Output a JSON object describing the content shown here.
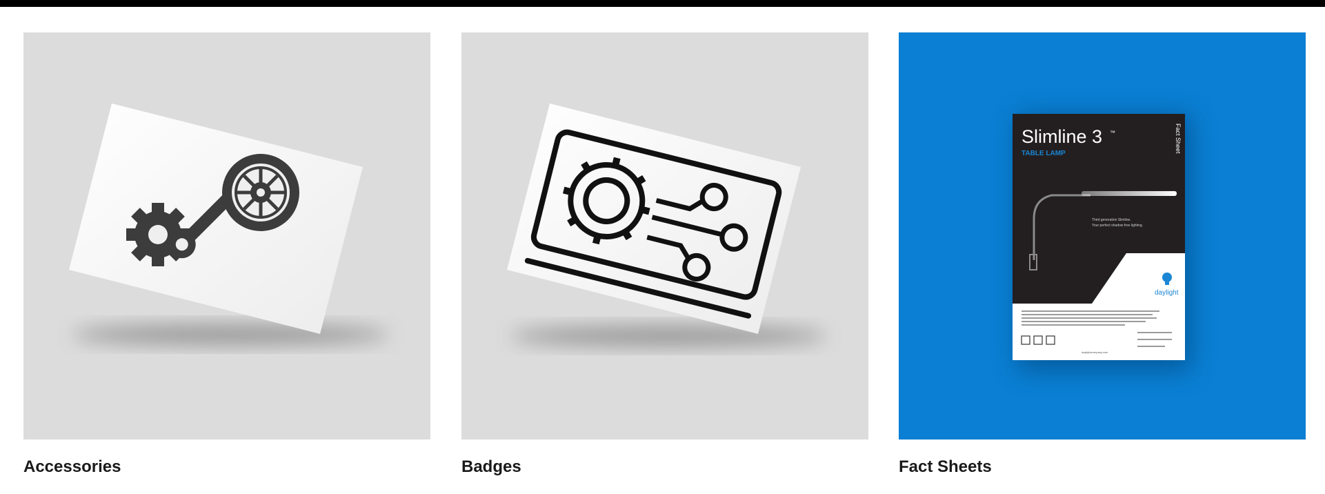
{
  "cards": [
    {
      "title": "Accessories"
    },
    {
      "title": "Badges"
    },
    {
      "title": "Fact Sheets",
      "booklet": {
        "heading": "Slimline 3",
        "trademark": "™",
        "subheading": "TABLE LAMP",
        "side_label": "Fact Sheet",
        "tagline_1": "Third generation Slimline.",
        "tagline_2": "Your perfect shadow free lighting.",
        "brand": "daylight",
        "url": "daylightcompany.com"
      }
    }
  ],
  "colors": {
    "card_grey": "#dcdcdc",
    "card_blue": "#0a7fd3",
    "booklet_dark": "#231f20",
    "title_text": "#1a1a1a"
  }
}
